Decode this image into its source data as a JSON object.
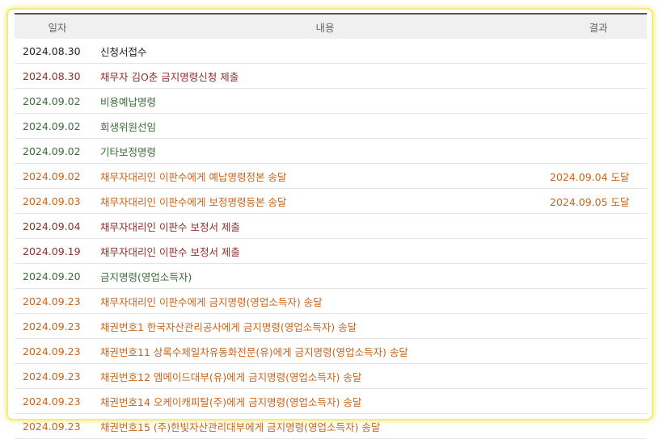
{
  "header": {
    "date": "일자",
    "content": "내용",
    "result": "결과"
  },
  "colors": {
    "black": "#222222",
    "red": "#8a2f2a",
    "green": "#3c6b3a",
    "orange": "#c8641a"
  },
  "rows": [
    {
      "date": "2024.08.30",
      "content": "신청서접수",
      "result": "",
      "tone": "black"
    },
    {
      "date": "2024.08.30",
      "content": "채무자 김O춘 금지명령신청 제출",
      "result": "",
      "tone": "red"
    },
    {
      "date": "2024.09.02",
      "content": "비용예납명령",
      "result": "",
      "tone": "green"
    },
    {
      "date": "2024.09.02",
      "content": "회생위원선임",
      "result": "",
      "tone": "green"
    },
    {
      "date": "2024.09.02",
      "content": "기타보정명령",
      "result": "",
      "tone": "green"
    },
    {
      "date": "2024.09.02",
      "content": "채무자대리인 이판수에게 예납명령정본 송달",
      "result": "2024.09.04 도달",
      "tone": "orange"
    },
    {
      "date": "2024.09.03",
      "content": "채무자대리인 이판수에게 보정명령등본 송달",
      "result": "2024.09.05 도달",
      "tone": "orange"
    },
    {
      "date": "2024.09.04",
      "content": "채무자대리인 이판수 보정서 제출",
      "result": "",
      "tone": "red"
    },
    {
      "date": "2024.09.19",
      "content": "채무자대리인 이판수 보정서 제출",
      "result": "",
      "tone": "red"
    },
    {
      "date": "2024.09.20",
      "content": "금지명령(영업소득자)",
      "result": "",
      "tone": "green"
    },
    {
      "date": "2024.09.23",
      "content": "채무자대리인 이판수에게 금지명령(영업소득자) 송달",
      "result": "",
      "tone": "orange"
    },
    {
      "date": "2024.09.23",
      "content": "채권번호1 한국자산관리공사에게 금지명령(영업소득자) 송달",
      "result": "",
      "tone": "orange"
    },
    {
      "date": "2024.09.23",
      "content": "채권번호11 상록수제일차유동화전문(유)에게 금지명령(영업소득자) 송달",
      "result": "",
      "tone": "orange"
    },
    {
      "date": "2024.09.23",
      "content": "채권번호12 엠메이드대부(유)에게 금지명령(영업소득자) 송달",
      "result": "",
      "tone": "orange"
    },
    {
      "date": "2024.09.23",
      "content": "채권번호14 오케이캐피탈(주)에게 금지명령(영업소득자) 송달",
      "result": "",
      "tone": "orange"
    },
    {
      "date": "2024.09.23",
      "content": "채권번호15 (주)한빛자산관리대부에게 금지명령(영업소득자) 송달",
      "result": "",
      "tone": "orange"
    }
  ]
}
